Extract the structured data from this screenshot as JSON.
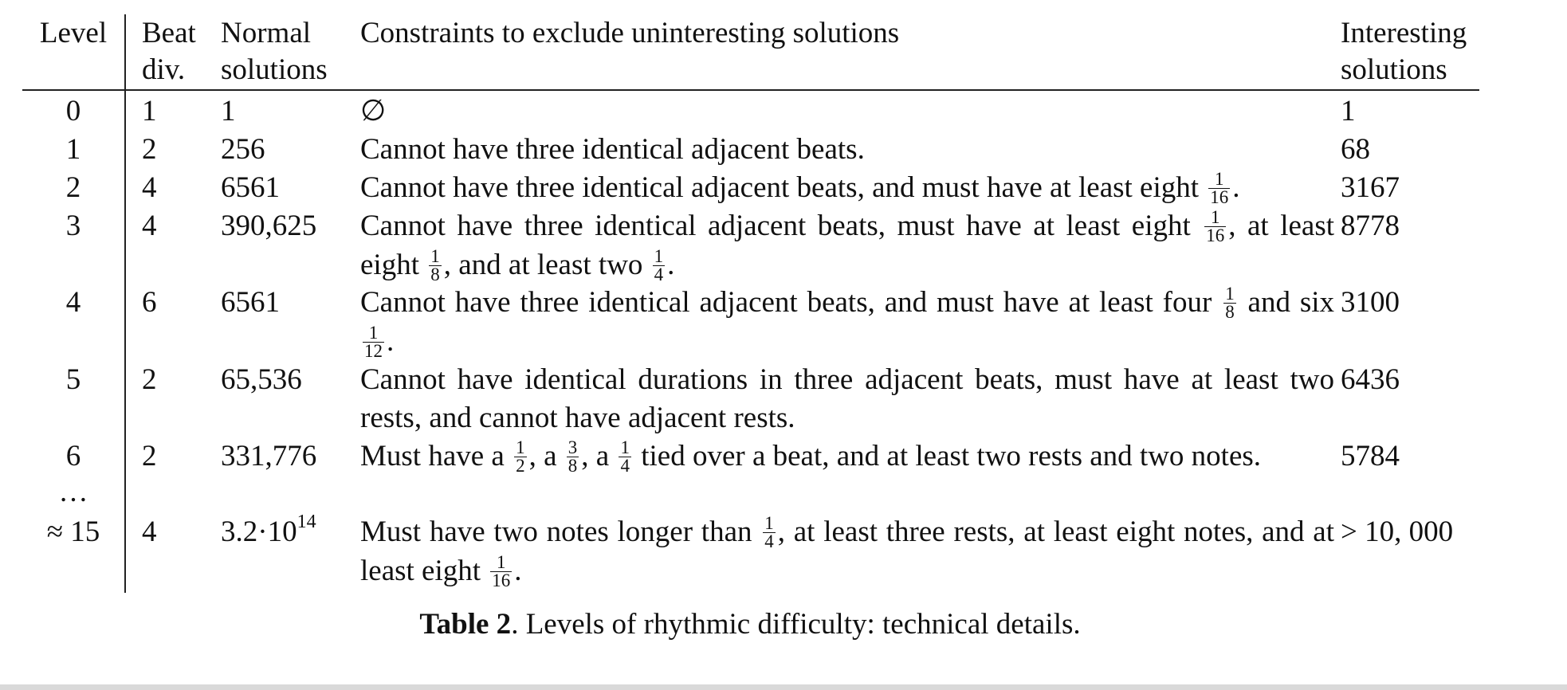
{
  "table": {
    "headers": {
      "level": "Level",
      "beat_div_1": "Beat",
      "beat_div_2": "div.",
      "normal_1": "Normal",
      "normal_2": "solutions",
      "constraints": "Constraints to exclude uninteresting solutions",
      "interesting_1": "Interesting",
      "interesting_2": "solutions"
    },
    "rows": [
      {
        "level": "0",
        "beat_div": "1",
        "normal": "1",
        "interesting": "1",
        "constraint": {
          "p1": "∅"
        }
      },
      {
        "level": "1",
        "beat_div": "2",
        "normal": "256",
        "interesting": "68",
        "constraint": {
          "p1": "Cannot have three identical adjacent beats."
        }
      },
      {
        "level": "2",
        "beat_div": "4",
        "normal": "6561",
        "interesting": "3167",
        "constraint": {
          "p1": "Cannot have three identical adjacent beats, and must have at least eight",
          "f1n": "1",
          "f1d": "16",
          "p2": "."
        }
      },
      {
        "level": "3",
        "beat_div": "4",
        "normal": "390,625",
        "interesting": "8778",
        "constraint": {
          "p1": "Cannot have three identical adjacent beats, must have at least eight",
          "f1n": "1",
          "f1d": "16",
          "p2": ", at least eight",
          "f2n": "1",
          "f2d": "8",
          "p3": ", and at least two",
          "f3n": "1",
          "f3d": "4",
          "p4": "."
        }
      },
      {
        "level": "4",
        "beat_div": "6",
        "normal": "6561",
        "interesting": "3100",
        "constraint": {
          "p1": "Cannot have three identical adjacent beats, and must have at least four",
          "f1n": "1",
          "f1d": "8",
          "p2": "and six",
          "f2n": "1",
          "f2d": "12",
          "p3": "."
        }
      },
      {
        "level": "5",
        "beat_div": "2",
        "normal": "65,536",
        "interesting": "6436",
        "constraint": {
          "p1": "Cannot have identical durations in three adjacent beats, must have at least two rests, and cannot have adjacent rests."
        }
      },
      {
        "level": "6",
        "beat_div": "2",
        "normal": "331,776",
        "interesting": "5784",
        "constraint": {
          "p1": "Must have a",
          "f1n": "1",
          "f1d": "2",
          "p2": ", a",
          "f2n": "3",
          "f2d": "8",
          "p3": ", a",
          "f3n": "1",
          "f3d": "4",
          "p4": "tied over a beat, and at least two rests and two notes."
        }
      },
      {
        "level": "…"
      },
      {
        "level": "≈ 15",
        "beat_div": "4",
        "normal_base": "3.2·10",
        "normal_exp": "14",
        "interesting": "> 10, 000",
        "constraint": {
          "p1": "Must have two notes longer than",
          "f1n": "1",
          "f1d": "4",
          "p2": ", at least three rests, at least eight notes, and at least eight",
          "f2n": "1",
          "f2d": "16",
          "p3": "."
        }
      }
    ]
  },
  "caption": {
    "label": "Table 2",
    "text": ". Levels of rhythmic difficulty: technical details."
  }
}
